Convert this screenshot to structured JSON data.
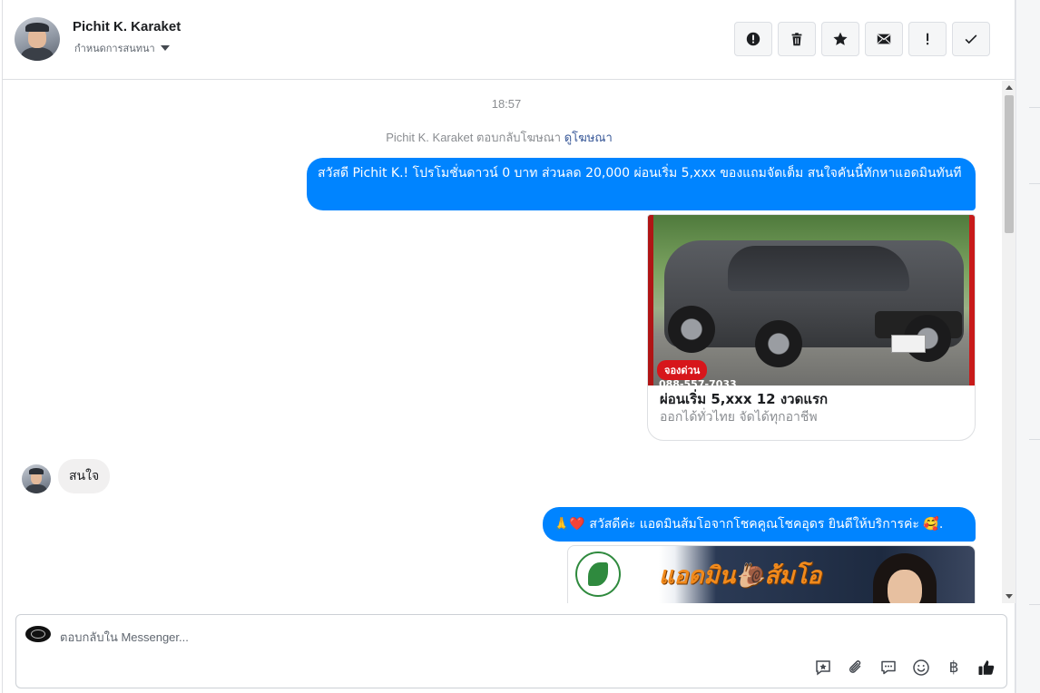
{
  "header": {
    "name": "Pichit K. Karaket",
    "subtitle": "กำหนดการสนทนา",
    "tools": [
      {
        "name": "report-icon",
        "label": "!"
      },
      {
        "name": "trash-icon",
        "label": ""
      },
      {
        "name": "star-icon",
        "label": ""
      },
      {
        "name": "mail-icon",
        "label": ""
      },
      {
        "name": "exclamation-icon",
        "label": "!"
      },
      {
        "name": "check-icon",
        "label": ""
      }
    ]
  },
  "thread": {
    "timestamp": "18:57",
    "reply_note": "Pichit K. Karaket ตอบกลับโฆษณา",
    "reply_link": "ดูโฆษณา",
    "messages": [
      {
        "from": "page",
        "text": "สวัสดี Pichit K.! โปรโมชั่นดาวน์ 0 บาท ส่วนลด 20,000 ผ่อนเริ่ม 5,xxx ของแถมจัดเต็ม สนใจคันนี้ทักหาแอดมินทันที"
      },
      {
        "from": "page",
        "type": "card",
        "badge": "จองด่วน",
        "phone": "088-557-7033",
        "title": "ผ่อนเริ่ม 5,xxx 12 งวดแรก",
        "description": "ออกได้ทั่วไทย จัดได้ทุกอาชีพ"
      },
      {
        "from": "user",
        "text": "สนใจ"
      },
      {
        "from": "page",
        "text": "🙏❤️ สวัสดีค่ะ แอดมินส้มโอจากโชคคูณโชคอุดร ยินดีให้บริการค่ะ 🥰."
      },
      {
        "from": "page",
        "type": "image",
        "headline": "แอดมิน🐌ส้มโอ"
      }
    ]
  },
  "composer": {
    "placeholder": "ตอบกลับใน Messenger...",
    "tools": [
      "saved-reply-icon",
      "attachment-icon",
      "chat-bubble-icon",
      "emoji-icon",
      "baht-icon",
      "thumbs-up-icon"
    ],
    "baht_symbol": "฿"
  },
  "colors": {
    "accent": "#0084ff",
    "incoming_bubble": "#f1f0f0"
  }
}
